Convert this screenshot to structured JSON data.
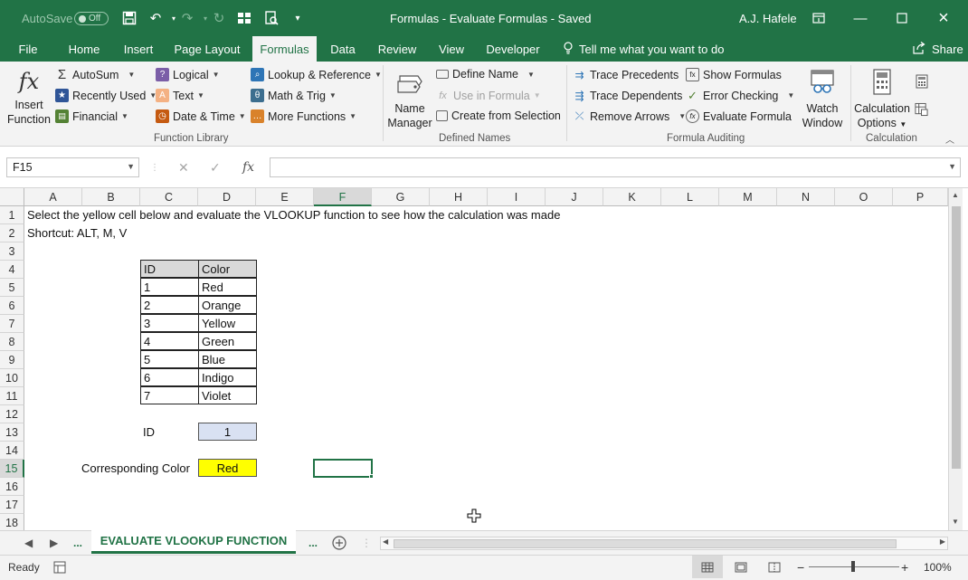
{
  "titlebar": {
    "autosave_label": "AutoSave",
    "autosave_state": "Off",
    "document_title": "Formulas - Evaluate Formulas  -  Saved",
    "user_name": "A.J. Hafele"
  },
  "tabs": [
    "File",
    "Home",
    "Insert",
    "Page Layout",
    "Formulas",
    "Data",
    "Review",
    "View",
    "Developer"
  ],
  "active_tab": "Formulas",
  "tell_me": "Tell me what you want to do",
  "share_label": "Share",
  "ribbon": {
    "insert_function": [
      "Insert",
      "Function"
    ],
    "function_library": {
      "autosum": "AutoSum",
      "recently_used": "Recently Used",
      "financial": "Financial",
      "logical": "Logical",
      "text": "Text",
      "date_time": "Date & Time",
      "lookup_reference": "Lookup & Reference",
      "math_trig": "Math & Trig",
      "more_functions": "More Functions",
      "group_label": "Function Library"
    },
    "defined_names": {
      "name_manager": [
        "Name",
        "Manager"
      ],
      "define_name": "Define Name",
      "use_in_formula": "Use in Formula",
      "create_from_selection": "Create from Selection",
      "group_label": "Defined Names"
    },
    "formula_auditing": {
      "trace_precedents": "Trace Precedents",
      "trace_dependents": "Trace Dependents",
      "remove_arrows": "Remove Arrows",
      "show_formulas": "Show Formulas",
      "error_checking": "Error Checking",
      "evaluate_formula": "Evaluate Formula",
      "watch_window": [
        "Watch",
        "Window"
      ],
      "group_label": "Formula Auditing"
    },
    "calculation": {
      "calculation_options": [
        "Calculation",
        "Options"
      ],
      "group_label": "Calculation"
    }
  },
  "formula_bar": {
    "name_box": "F15",
    "formula": ""
  },
  "columns": [
    "A",
    "B",
    "C",
    "D",
    "E",
    "F",
    "G",
    "H",
    "I",
    "J",
    "K",
    "L",
    "M",
    "N",
    "O",
    "P"
  ],
  "selected_column": "F",
  "rows": [
    "1",
    "2",
    "3",
    "4",
    "5",
    "6",
    "7",
    "8",
    "9",
    "10",
    "11",
    "12",
    "13",
    "14",
    "15",
    "16",
    "17",
    "18"
  ],
  "selected_row": "15",
  "sheet": {
    "a1": "Select the yellow cell below and evaluate the VLOOKUP function to see how the calculation was made",
    "a2": "Shortcut: ALT, M, V",
    "table_headers": [
      "ID",
      "Color"
    ],
    "table_rows": [
      [
        "1",
        "Red"
      ],
      [
        "2",
        "Orange"
      ],
      [
        "3",
        "Yellow"
      ],
      [
        "4",
        "Green"
      ],
      [
        "5",
        "Blue"
      ],
      [
        "6",
        "Indigo"
      ],
      [
        "7",
        "Violet"
      ]
    ],
    "id_label": "ID",
    "id_value": "1",
    "corresponding_label": "Corresponding Color",
    "corresponding_value": "Red"
  },
  "sheet_tab": "EVALUATE VLOOKUP FUNCTION",
  "status": {
    "ready": "Ready",
    "zoom": "100%"
  },
  "colors": {
    "excel_green": "#217346",
    "lookup_input_fill": "#d9e1f2",
    "result_fill": "#ffff00"
  }
}
